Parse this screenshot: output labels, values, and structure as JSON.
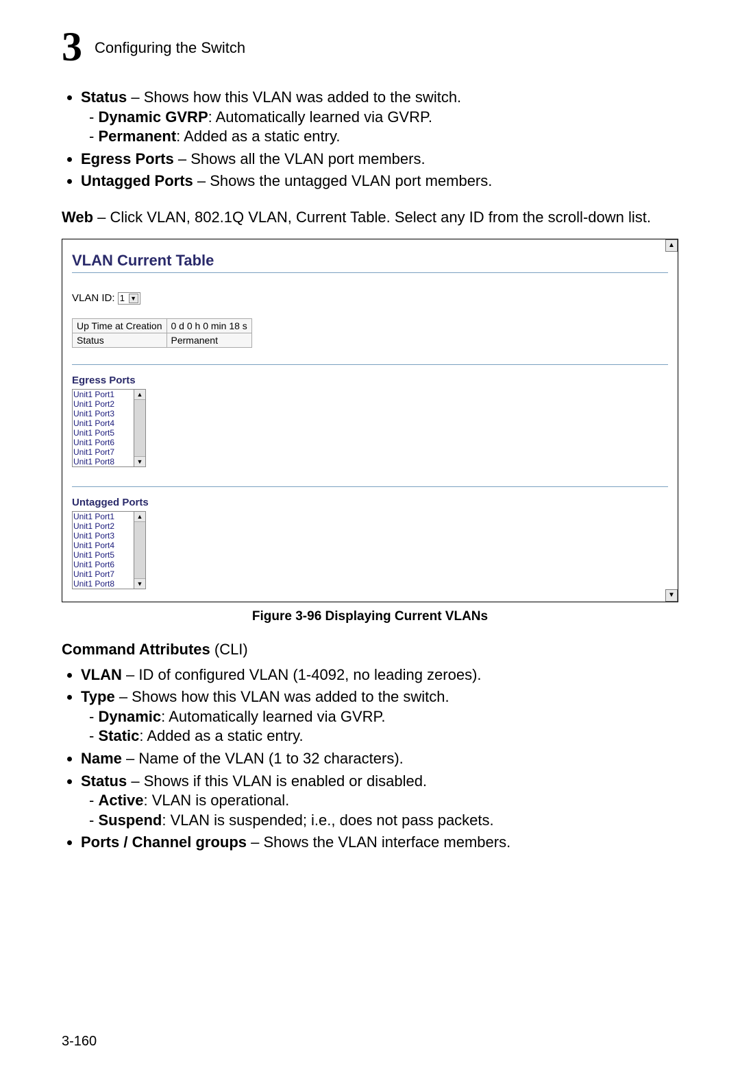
{
  "header": {
    "chapter_number": "3",
    "chapter_title": "Configuring the Switch"
  },
  "top_bullets": {
    "status": {
      "term": "Status",
      "desc": " – Shows how this VLAN was added to the switch.",
      "sub1_term": "Dynamic GVRP",
      "sub1_desc": ": Automatically learned via GVRP.",
      "sub2_term": "Permanent",
      "sub2_desc": ": Added as a static entry."
    },
    "egress": {
      "term": "Egress Ports",
      "desc": " – Shows all the VLAN port members."
    },
    "untagged": {
      "term": "Untagged Ports",
      "desc": " – Shows the untagged VLAN port members."
    }
  },
  "web_line": {
    "term": "Web",
    "desc": " – Click VLAN, 802.1Q VLAN, Current Table. Select any ID from the scroll-down list."
  },
  "figure": {
    "title": "VLAN Current Table",
    "vlan_id_label": "VLAN ID:",
    "vlan_id_value": "1",
    "kv_rows": [
      {
        "k": "Up Time at Creation",
        "v": "0 d 0 h 0 min 18 s"
      },
      {
        "k": "Status",
        "v": "Permanent"
      }
    ],
    "egress_heading": "Egress Ports",
    "untagged_heading": "Untagged Ports",
    "port_options": [
      "Unit1 Port1",
      "Unit1 Port2",
      "Unit1 Port3",
      "Unit1 Port4",
      "Unit1 Port5",
      "Unit1 Port6",
      "Unit1 Port7",
      "Unit1 Port8"
    ]
  },
  "caption": "Figure 3-96  Displaying Current VLANs",
  "cli_section": {
    "heading_term": "Command Attributes",
    "heading_rest": " (CLI)",
    "vlan": {
      "term": "VLAN",
      "desc": " – ID of configured VLAN (1-4092, no leading zeroes)."
    },
    "type": {
      "term": "Type",
      "desc": " – Shows how this VLAN was added to the switch.",
      "sub1_term": "Dynamic",
      "sub1_desc": ": Automatically learned via GVRP.",
      "sub2_term": "Static",
      "sub2_desc": ": Added as a static entry."
    },
    "name": {
      "term": "Name",
      "desc": " – Name of the VLAN (1 to 32 characters)."
    },
    "status": {
      "term": "Status",
      "desc": " – Shows if this VLAN is enabled or disabled.",
      "sub1_term": "Active",
      "sub1_desc": ": VLAN is operational.",
      "sub2_term": "Suspend",
      "sub2_desc": ": VLAN is suspended; i.e., does not pass packets."
    },
    "ports": {
      "term": "Ports / Channel groups",
      "desc": " – Shows the VLAN interface members."
    }
  },
  "page_number": "3-160"
}
